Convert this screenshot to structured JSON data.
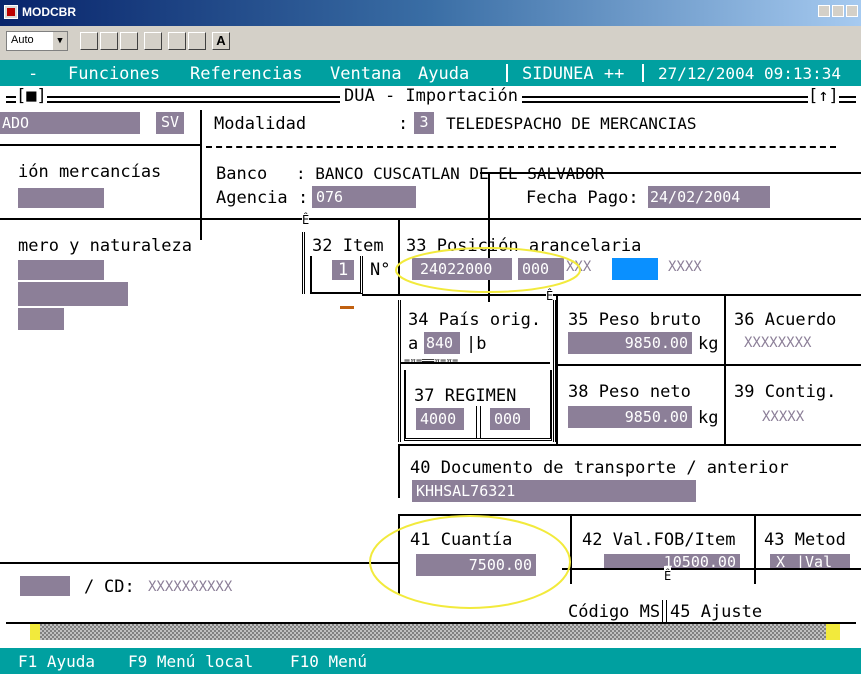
{
  "app": {
    "title": "MODCBR"
  },
  "toolbar": {
    "font_size": "Auto",
    "font_a": "A"
  },
  "menu": {
    "dash": "-",
    "items": [
      "Funciones",
      "Referencias",
      "Ventana",
      "Ayuda"
    ],
    "sidunea": "SIDUNEA ++",
    "datetime": "27/12/2004 09:13:34"
  },
  "frame": {
    "left_marker": "[■]",
    "title": "DUA - Importación",
    "right_marker": "[↑]"
  },
  "header": {
    "ado": "ADO",
    "sv": "SV",
    "modalidad_label": "Modalidad",
    "colon": ":",
    "modalidad_code": "3",
    "modalidad_desc": "TELEDESPACHO DE MERCANCIAS"
  },
  "bank": {
    "left_label": "ión mercancías",
    "banco_label": "Banco",
    "banco_value": ": BANCO CUSCATLAN DE EL SALVADOR",
    "agencia_label": "Agencia",
    "agencia_colon": ":",
    "agencia_value": "076",
    "fecha_label": "Fecha Pago:",
    "fecha_value": "24/02/2004",
    "e_mark": "Ê"
  },
  "goods": {
    "label": "mero y naturaleza"
  },
  "item": {
    "label": "32 Item",
    "number": "1",
    "n_label": "N°"
  },
  "posicion": {
    "label": "33 Posición arancelaria",
    "code": "24022000",
    "sub": "000",
    "x1": "XXX",
    "x2": "XXXX"
  },
  "pais": {
    "label": "34 País orig.",
    "prefix": "a",
    "code": "840",
    "suffix": "|b",
    "sep": "=¤=══¤=¤="
  },
  "peso_bruto": {
    "label": "35 Peso bruto",
    "value": "9850.00",
    "unit": "kg"
  },
  "acuerdo": {
    "label": "36 Acuerdo",
    "value": "XXXXXXXX"
  },
  "regimen": {
    "label": "37 REGIMEN",
    "code": "4000",
    "sub": "000"
  },
  "peso_neto": {
    "label": "38 Peso neto",
    "value": "9850.00",
    "unit": "kg"
  },
  "contig": {
    "label": "39 Contig.",
    "value": "XXXXX"
  },
  "documento": {
    "label": "40 Documento de transporte / anterior",
    "value": "KHHSAL76321"
  },
  "cuantia": {
    "label": "41 Cuantía",
    "value": "7500.00"
  },
  "fob": {
    "label": "42 Val.FOB/Item",
    "value": "10500.00"
  },
  "metodo": {
    "label": "43 Metod",
    "x": "X",
    "val": "|Val"
  },
  "cd": {
    "sep": "/",
    "label": "CD:",
    "value": "XXXXXXXXXX"
  },
  "codigo": {
    "label": "Código MS",
    "ajuste": "45 Ajuste"
  },
  "statusbar": {
    "items": [
      "F1 Ayuda",
      "F9 Menú local",
      "F10 Menú"
    ]
  },
  "colors": {
    "teal": "#00a0a0",
    "field": "#8c7f98",
    "highlight": "#0a90ff",
    "annotation": "#f2ea3c",
    "title_bar": "#08246b"
  }
}
